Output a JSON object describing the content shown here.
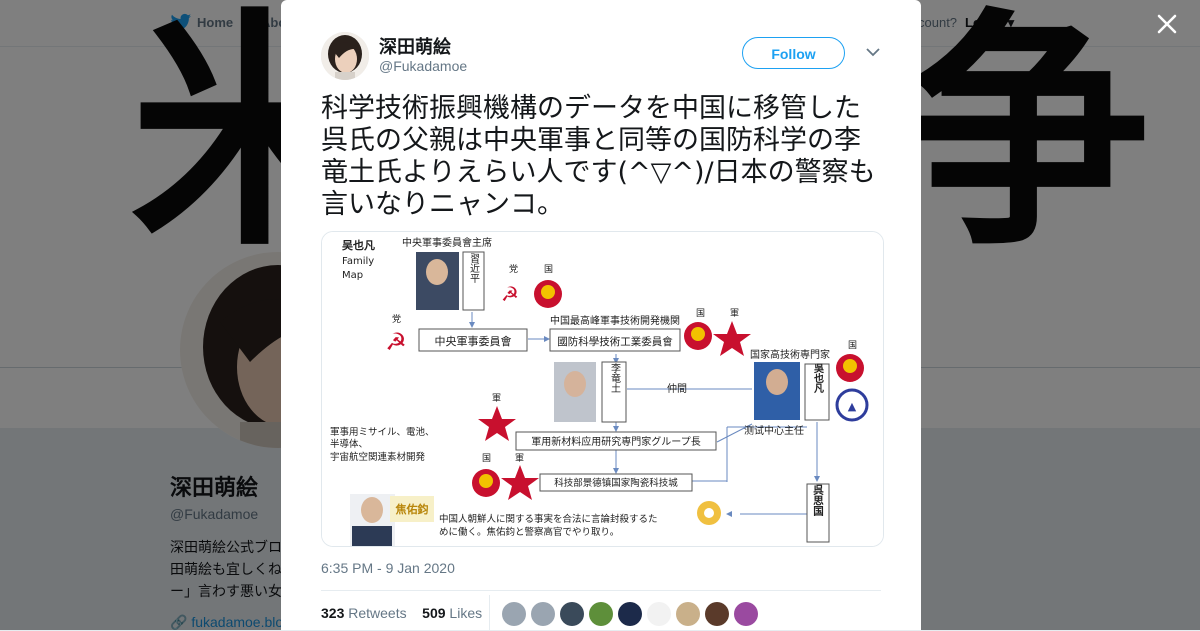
{
  "topbar": {
    "home_label": "Home",
    "about_label": "Abo",
    "account_text": "count?",
    "login_label": "Log in"
  },
  "banner": {
    "glyph_left": "米",
    "glyph_right": "争"
  },
  "profile": {
    "name": "深田萌絵",
    "handle": "@Fukadamoe",
    "bio_lines": [
      "深田萌絵公式ブロ",
      "田萌絵も宜しくね",
      "ー」言わす悪い女"
    ],
    "link": "fukadamoe.blo"
  },
  "tweet": {
    "author_name": "深田萌絵",
    "author_handle": "@Fukadamoe",
    "follow_label": "Follow",
    "text_lines": [
      "科学技術振興機構のデータを中国に移管した",
      "呉氏の父親は中央軍事と同等の国防科学の李",
      "竜土氏よりえらい人です(^▽^)/日本の警察も",
      "言いなりニャンコ。"
    ],
    "timestamp": "6:35 PM - 9 Jan 2020",
    "retweets_count": "323",
    "retweets_label": "Retweets",
    "likes_count": "509",
    "likes_label": "Likes",
    "liker_colors": [
      "#9aa5b1",
      "#9aa5b1",
      "#3a4a5a",
      "#5e8f3a",
      "#1c2a4a",
      "#f2f2f2",
      "#c9b08a",
      "#5a3a2a",
      "#9a4aa0"
    ]
  },
  "media": {
    "title": "吴也凡",
    "subtitle1": "Family",
    "subtitle2": "Map",
    "top_label": "中央軍事委員會主席",
    "xi_name": "習近平",
    "party": "党",
    "country": "国",
    "military": "軍",
    "cmc_box": "中央軍事委員會",
    "top_org_label": "中国最高峰軍事技術開発機関",
    "costind_box": "國防科學技術工業委員會",
    "li_name": "李竜土",
    "middle_label": "仲間",
    "expert_label": "国家高技術専門家",
    "wu_name": "吳也凡",
    "test_center": "测试中心主任",
    "materials_text1": "軍事用ミサイル、電池、",
    "materials_text2": "半導体、",
    "materials_text3": "宇宙航空関連素材開発",
    "group_box": "軍用新材料应用研究専門家グループ長",
    "ceramic_box": "科技部景德镇国家陶瓷科技城",
    "jiao_name": "焦佑鈞",
    "bottom_text1": "中国人朝鮮人に関する事実を合法に言論封殺するた",
    "bottom_text2": "めに働く。焦佑鈞と警察高官でやり取り。",
    "wu_si_name": "呉思国"
  }
}
